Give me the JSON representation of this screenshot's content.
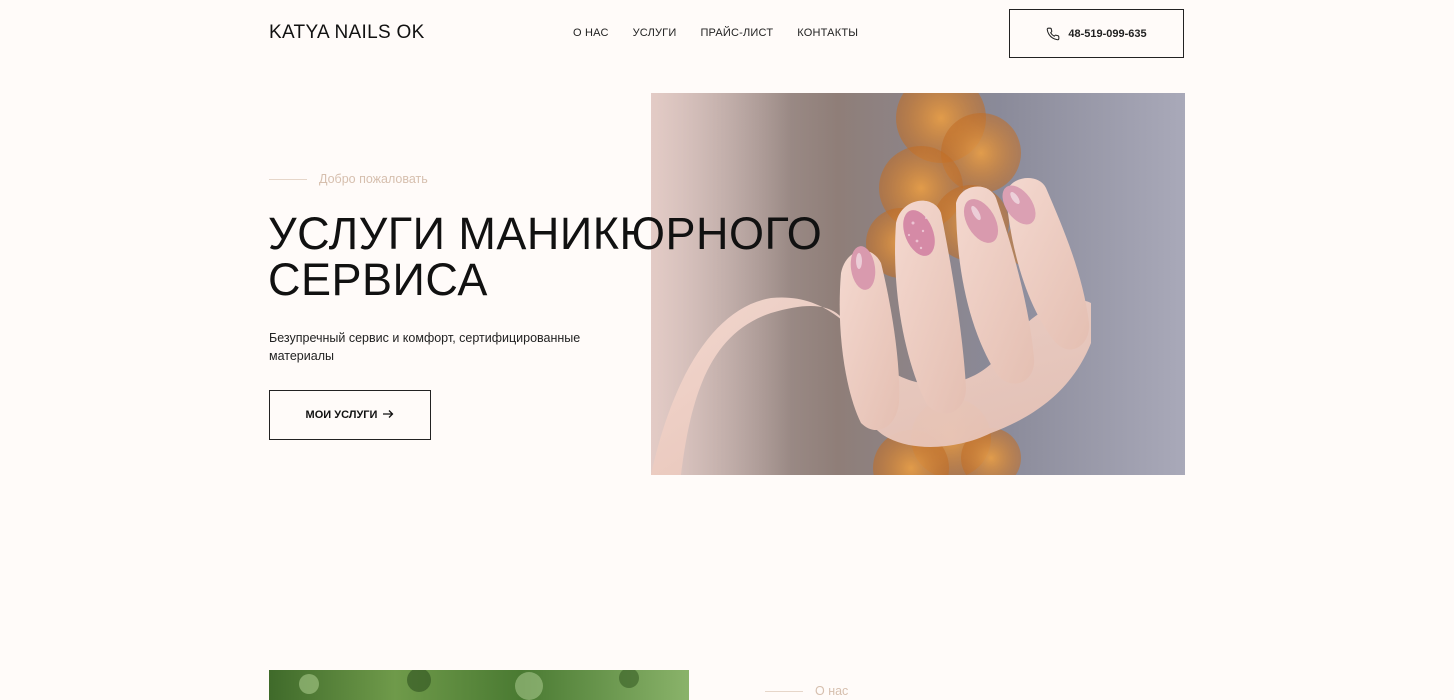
{
  "header": {
    "logo": "KATYA NAILS OK",
    "nav": [
      {
        "label": "О НАС"
      },
      {
        "label": "УСЛУГИ"
      },
      {
        "label": "ПРАЙС-ЛИСТ"
      },
      {
        "label": "КОНТАКТЫ"
      }
    ],
    "phone": "48-519-099-635",
    "phone_icon": "phone-icon"
  },
  "hero": {
    "kicker": "Добро пожаловать",
    "title_line1": "УСЛУГИ МАНИКЮРНОГО",
    "title_line2": "СЕРВИСА",
    "description": "Безупречный сервис и комфорт, сертифицированные материалы",
    "cta_label": "МОИ УСЛУГИ",
    "cta_icon": "arrow-right-icon"
  },
  "about": {
    "kicker": "О нас"
  },
  "colors": {
    "background": "#fffbf9",
    "accent_muted": "#d6bfae",
    "text": "#111111",
    "nail_pink": "#d99aae"
  }
}
